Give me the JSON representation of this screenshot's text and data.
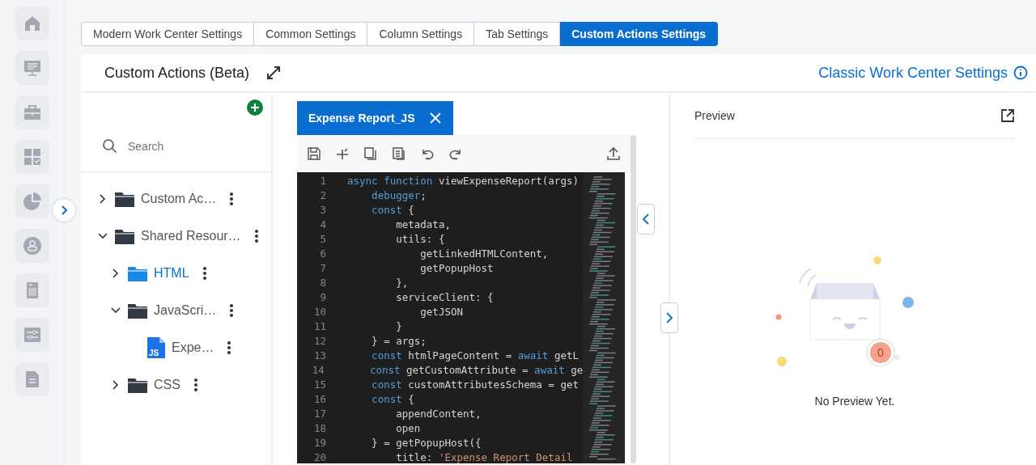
{
  "tabs": [
    {
      "label": "Modern Work Center Settings",
      "selected": false
    },
    {
      "label": "Common Settings",
      "selected": false
    },
    {
      "label": "Column Settings",
      "selected": false
    },
    {
      "label": "Tab Settings",
      "selected": false
    },
    {
      "label": "Custom Actions Settings",
      "selected": true
    }
  ],
  "header": {
    "title": "Custom Actions (Beta)",
    "link": "Classic Work Center Settings"
  },
  "tree": {
    "search": {
      "placeholder": "Search"
    },
    "items": [
      {
        "kind": "folder",
        "label": "Custom Ac…",
        "expanded": false,
        "selected": false
      },
      {
        "kind": "folder",
        "label": "Shared Resour…",
        "expanded": true,
        "selected": false,
        "children": [
          {
            "kind": "folder",
            "label": "HTML",
            "expanded": false,
            "selected": true
          },
          {
            "kind": "folder",
            "label": "JavaScri…",
            "expanded": true,
            "selected": false,
            "children": [
              {
                "kind": "file",
                "icon_text": "JS",
                "label": "Expe…",
                "selected": false
              }
            ]
          },
          {
            "kind": "folder",
            "label": "CSS",
            "expanded": false,
            "selected": false
          }
        ]
      }
    ]
  },
  "editor": {
    "file_tab": "Expense Report_JS",
    "lines": [
      {
        "number": "1",
        "tokens": [
          {
            "kind": "kw",
            "text": "async function"
          },
          {
            "kind": "plain",
            "text": " viewExpenseReport(args)"
          }
        ]
      },
      {
        "number": "2",
        "tokens": [
          {
            "kind": "kw",
            "text": "    debugger"
          },
          {
            "kind": "plain",
            "text": ";"
          }
        ]
      },
      {
        "number": "3",
        "tokens": [
          {
            "kind": "kw",
            "text": "    const"
          },
          {
            "kind": "plain",
            "text": " {"
          }
        ]
      },
      {
        "number": "4",
        "tokens": [
          {
            "kind": "plain",
            "text": "        metadata,"
          }
        ]
      },
      {
        "number": "5",
        "tokens": [
          {
            "kind": "plain",
            "text": "        utils: {"
          }
        ]
      },
      {
        "number": "6",
        "tokens": [
          {
            "kind": "plain",
            "text": "            getLinkedHTMLContent,"
          }
        ]
      },
      {
        "number": "7",
        "tokens": [
          {
            "kind": "plain",
            "text": "            getPopupHost"
          }
        ]
      },
      {
        "number": "8",
        "tokens": [
          {
            "kind": "plain",
            "text": "        },"
          }
        ]
      },
      {
        "number": "9",
        "tokens": [
          {
            "kind": "plain",
            "text": "        serviceClient: {"
          }
        ]
      },
      {
        "number": "10",
        "tokens": [
          {
            "kind": "plain",
            "text": "            getJSON"
          }
        ]
      },
      {
        "number": "11",
        "tokens": [
          {
            "kind": "plain",
            "text": "        }"
          }
        ]
      },
      {
        "number": "12",
        "tokens": [
          {
            "kind": "plain",
            "text": "    } = args;"
          }
        ]
      },
      {
        "number": "13",
        "tokens": [
          {
            "kind": "kw",
            "text": "    const"
          },
          {
            "kind": "plain",
            "text": " htmlPageContent = "
          },
          {
            "kind": "kw",
            "text": "await"
          },
          {
            "kind": "plain",
            "text": " getL"
          }
        ]
      },
      {
        "number": "14",
        "tokens": [
          {
            "kind": "kw",
            "text": "    const"
          },
          {
            "kind": "plain",
            "text": " getCustomAttribute = "
          },
          {
            "kind": "kw",
            "text": "await"
          },
          {
            "kind": "plain",
            "text": " ge"
          }
        ]
      },
      {
        "number": "15",
        "tokens": [
          {
            "kind": "kw",
            "text": "    const"
          },
          {
            "kind": "plain",
            "text": " customAttributesSchema = get"
          }
        ]
      },
      {
        "number": "16",
        "tokens": [
          {
            "kind": "kw",
            "text": "    const"
          },
          {
            "kind": "plain",
            "text": " {"
          }
        ]
      },
      {
        "number": "17",
        "tokens": [
          {
            "kind": "plain",
            "text": "        appendContent,"
          }
        ]
      },
      {
        "number": "18",
        "tokens": [
          {
            "kind": "plain",
            "text": "        open"
          }
        ]
      },
      {
        "number": "19",
        "tokens": [
          {
            "kind": "plain",
            "text": "    } = getPopupHost({"
          }
        ]
      },
      {
        "number": "20",
        "tokens": [
          {
            "kind": "plain",
            "text": "        title: "
          },
          {
            "kind": "str",
            "text": "'Expense Report Detail"
          }
        ]
      }
    ]
  },
  "preview": {
    "title": "Preview",
    "badge": "0",
    "message": "No Preview Yet."
  }
}
